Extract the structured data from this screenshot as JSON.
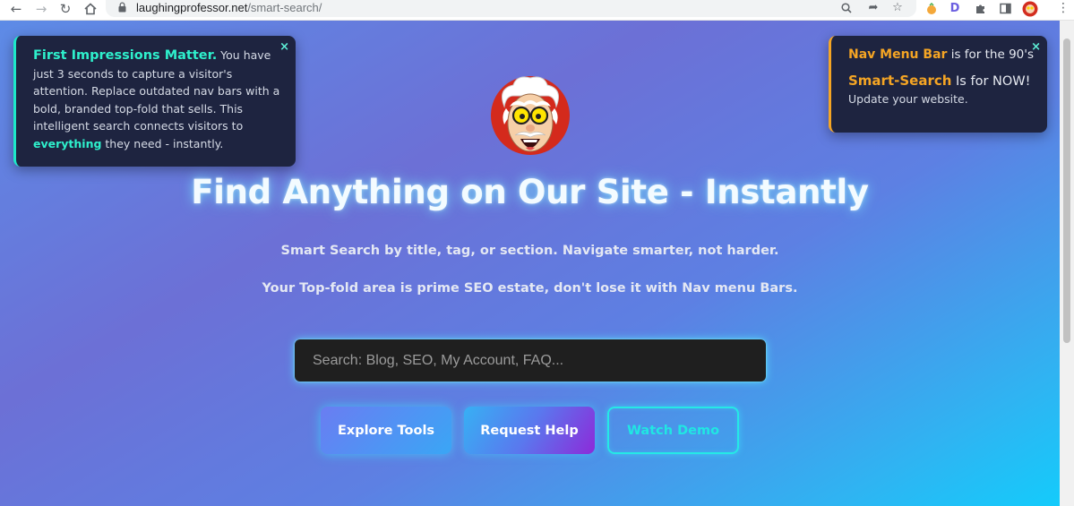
{
  "browser": {
    "url_domain": "laughingprofessor.net",
    "url_path": "/smart-search/"
  },
  "left_card": {
    "close": "×",
    "heading": "First Impressions Matter.",
    "text1": " You have just 3 seconds to capture a visitor's attention. Replace outdated nav bars with a bold, branded top-fold that sells. This intelligent search connects visitors to ",
    "highlight": "everything",
    "text2": " they need - instantly."
  },
  "right_card": {
    "close": "×",
    "line1_highlight": "Nav Menu Bar",
    "line1_rest": " is for the 90's",
    "line2_highlight": "Smart-Search",
    "line2_rest": " Is for NOW!",
    "line3": "Update your website."
  },
  "hero": {
    "headline": "Find Anything on Our Site - Instantly",
    "subline1": "Smart Search by title, tag, or section. Navigate smarter, not harder.",
    "subline2": "Your Top-fold area is prime SEO estate, don't lose it with Nav menu Bars."
  },
  "search": {
    "placeholder": "Search: Blog, SEO, My Account, FAQ...",
    "value": ""
  },
  "buttons": {
    "explore": "Explore Tools",
    "help": "Request Help",
    "demo": "Watch Demo"
  },
  "icons": {
    "back": "back-arrow-icon",
    "forward": "forward-arrow-icon",
    "reload": "reload-icon",
    "home": "home-icon",
    "lock": "lock-icon",
    "zoom": "zoom-icon",
    "share": "share-icon",
    "bookmark": "star-icon",
    "extensions": "puzzle-icon",
    "sidepanel": "side-panel-icon",
    "mascot": "professor-mascot-logo"
  },
  "colors": {
    "accent_teal": "#2ef0cc",
    "accent_orange": "#f5a524",
    "card_bg": "#1e2440",
    "search_bg": "#1f1f1f"
  }
}
